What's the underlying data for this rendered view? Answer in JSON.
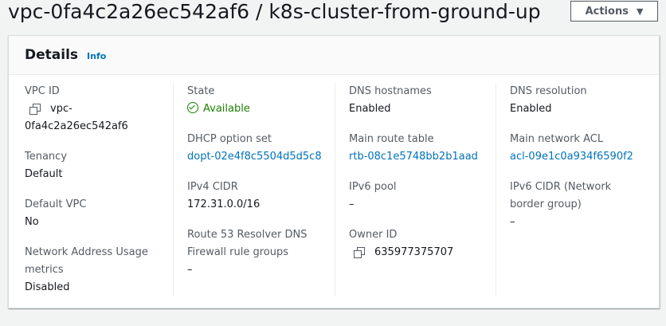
{
  "page": {
    "title": "vpc-0fa4c2a26ec542af6 / k8s-cluster-from-ground-up",
    "actions_label": "Actions"
  },
  "details": {
    "title": "Details",
    "info_label": "Info",
    "vpc_id_label": "VPC ID",
    "vpc_id_line1": "vpc-",
    "vpc_id_line2": "0fa4c2a26ec542af6",
    "tenancy_label": "Tenancy",
    "tenancy_value": "Default",
    "default_vpc_label": "Default VPC",
    "default_vpc_value": "No",
    "nau_label_line1": "Network Address Usage",
    "nau_label_line2": "metrics",
    "nau_value": "Disabled",
    "state_label": "State",
    "state_value": "Available",
    "dhcp_label": "DHCP option set",
    "dhcp_value": "dopt-02e4f8c5504d5d5c8",
    "ipv4_label": "IPv4 CIDR",
    "ipv4_value": "172.31.0.0/16",
    "r53_label_line1": "Route 53 Resolver DNS",
    "r53_label_line2": "Firewall rule groups",
    "r53_value": "–",
    "dns_hostnames_label": "DNS hostnames",
    "dns_hostnames_value": "Enabled",
    "main_route_label": "Main route table",
    "main_route_value": "rtb-08c1e5748bb2b1aad",
    "ipv6_pool_label": "IPv6 pool",
    "ipv6_pool_value": "–",
    "owner_label": "Owner ID",
    "owner_value": "635977375707",
    "dns_resolution_label": "DNS resolution",
    "dns_resolution_value": "Enabled",
    "main_acl_label": "Main network ACL",
    "main_acl_value": "acl-09e1c0a934f6590f2",
    "ipv6_cidr_label_line1": "IPv6 CIDR (Network",
    "ipv6_cidr_label_line2": "border group)",
    "ipv6_cidr_value": "–"
  },
  "colors": {
    "link": "#0073bb",
    "status_ok": "#1d8102",
    "label": "#545b64",
    "page_bg": "#f2f3f3"
  },
  "icons": [
    "copy-icon",
    "status-available-icon",
    "caret-down-icon"
  ]
}
